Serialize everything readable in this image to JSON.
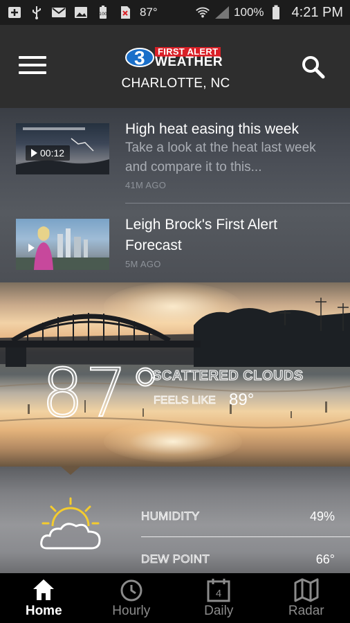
{
  "status_bar": {
    "temperature": "87°",
    "battery_level": "100%",
    "time": "4:21 PM",
    "icons": [
      "add-box-icon",
      "usb-icon",
      "mail-icon",
      "image-icon",
      "battery-full-icon",
      "no-sim-icon",
      "wifi-icon",
      "signal-icon",
      "battery-icon"
    ]
  },
  "header": {
    "logo_number": "3",
    "logo_first_alert": "FIRST ALERT",
    "logo_weather": "WEATHER",
    "location": "CHARLOTTE, NC",
    "menu_icon": "hamburger-menu-icon",
    "search_icon": "search-icon"
  },
  "stories": [
    {
      "title": "High heat easing this week",
      "description": "Take a look at the heat last week and compare it to this...",
      "time": "41M AGO",
      "duration": "00:12"
    },
    {
      "title": "Leigh Brock's First Alert Forecast",
      "description": "",
      "time": "5M AGO",
      "duration": ""
    }
  ],
  "current": {
    "temperature": "87°",
    "condition": "SCATTERED CLOUDS",
    "feels_like_label": "FEELS LIKE",
    "feels_like_value": "89°",
    "icon": "partly-sunny-icon"
  },
  "details": [
    {
      "label": "HUMIDITY",
      "value": "49%"
    },
    {
      "label": "DEW POINT",
      "value": "66°"
    }
  ],
  "bottom_nav": [
    {
      "label": "Home",
      "icon": "home-icon",
      "active": true
    },
    {
      "label": "Hourly",
      "icon": "clock-icon",
      "active": false
    },
    {
      "label": "Daily",
      "icon": "calendar-icon",
      "active": false,
      "badge": "4"
    },
    {
      "label": "Radar",
      "icon": "map-icon",
      "active": false
    }
  ]
}
